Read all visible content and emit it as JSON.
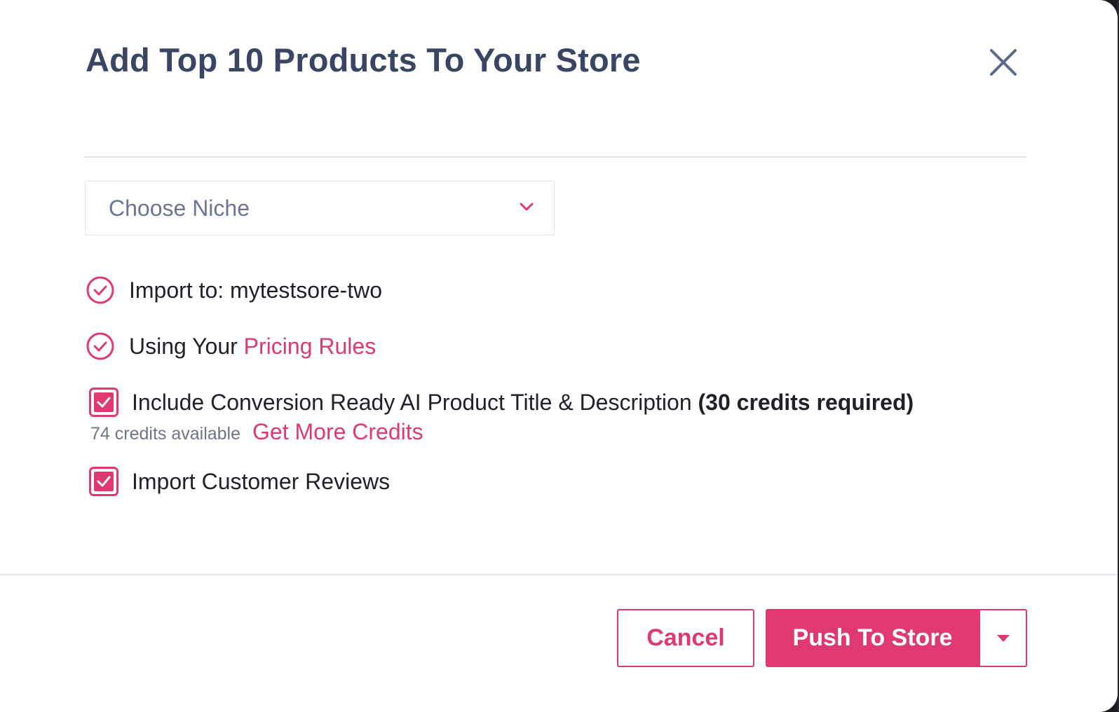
{
  "modal": {
    "title": "Add Top 10 Products To Your Store"
  },
  "niche_select": {
    "placeholder": "Choose Niche"
  },
  "options": {
    "import_to": "Import to: mytestsore-two",
    "pricing_prefix": "Using Your ",
    "pricing_link": "Pricing Rules",
    "ai_title_text": "Include Conversion Ready AI Product Title & Description ",
    "ai_title_credits": "(30 credits required)",
    "ai_title_checked": true,
    "credits_available": "74 credits available",
    "get_more_credits": "Get More Credits",
    "import_reviews": "Import Customer Reviews",
    "import_reviews_checked": true
  },
  "footer": {
    "cancel_label": "Cancel",
    "push_label": "Push To Store"
  },
  "colors": {
    "accent": "#e0396f",
    "title": "#3a4563",
    "placeholder": "#6b7597"
  },
  "icons": {
    "close": "close-icon",
    "select": "chevron-down-icon",
    "status": "check-circle-icon",
    "checkbox": "checkbox-checked-icon",
    "push_menu": "caret-down-icon"
  }
}
